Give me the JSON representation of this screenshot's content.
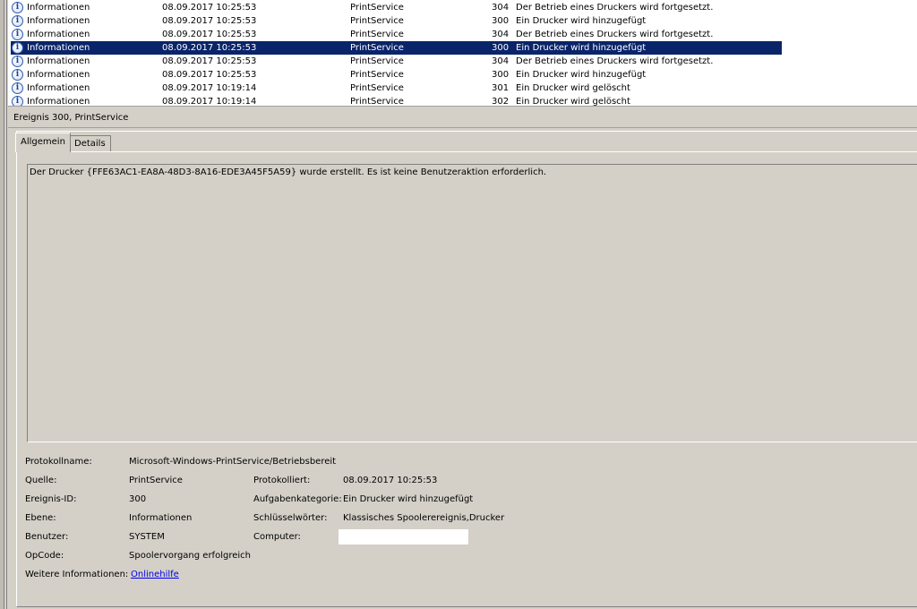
{
  "events": [
    {
      "level": "Informationen",
      "date": "08.09.2017 10:25:53",
      "source": "PrintService",
      "id": "304",
      "category": "Der Betrieb eines Druckers wird fortgesetzt.",
      "selected": false
    },
    {
      "level": "Informationen",
      "date": "08.09.2017 10:25:53",
      "source": "PrintService",
      "id": "300",
      "category": "Ein Drucker wird hinzugefügt",
      "selected": false
    },
    {
      "level": "Informationen",
      "date": "08.09.2017 10:25:53",
      "source": "PrintService",
      "id": "304",
      "category": "Der Betrieb eines Druckers wird fortgesetzt.",
      "selected": false
    },
    {
      "level": "Informationen",
      "date": "08.09.2017 10:25:53",
      "source": "PrintService",
      "id": "300",
      "category": "Ein Drucker wird hinzugefügt",
      "selected": true
    },
    {
      "level": "Informationen",
      "date": "08.09.2017 10:25:53",
      "source": "PrintService",
      "id": "304",
      "category": "Der Betrieb eines Druckers wird fortgesetzt.",
      "selected": false
    },
    {
      "level": "Informationen",
      "date": "08.09.2017 10:25:53",
      "source": "PrintService",
      "id": "300",
      "category": "Ein Drucker wird hinzugefügt",
      "selected": false
    },
    {
      "level": "Informationen",
      "date": "08.09.2017 10:19:14",
      "source": "PrintService",
      "id": "301",
      "category": "Ein Drucker wird gelöscht",
      "selected": false
    },
    {
      "level": "Informationen",
      "date": "08.09.2017 10:19:14",
      "source": "PrintService",
      "id": "302",
      "category": "Ein Drucker wird gelöscht",
      "selected": false
    }
  ],
  "detail": {
    "header": "Ereignis 300, PrintService",
    "tabs": [
      "Allgemein",
      "Details"
    ],
    "description": "Der Drucker {FFE63AC1-EA8A-48D3-8A16-EDE3A45F5A59} wurde erstellt. Es ist keine Benutzeraktion erforderlich.",
    "props": {
      "protokollname_label": "Protokollname:",
      "protokollname": "Microsoft-Windows-PrintService/Betriebsbereit",
      "quelle_label": "Quelle:",
      "quelle": "PrintService",
      "protokolliert_label": "Protokolliert:",
      "protokolliert": "08.09.2017 10:25:53",
      "ereignis_id_label": "Ereignis-ID:",
      "ereignis_id": "300",
      "aufgabenkategorie_label": "Aufgabenkategorie:",
      "aufgabenkategorie": "Ein Drucker wird hinzugefügt",
      "ebene_label": "Ebene:",
      "ebene": "Informationen",
      "schluesselwoerter_label": "Schlüsselwörter:",
      "schluesselwoerter": "Klassisches Spoolerereignis,Drucker",
      "benutzer_label": "Benutzer:",
      "benutzer": "SYSTEM",
      "computer_label": "Computer:",
      "opcode_label": "OpCode:",
      "opcode": "Spoolervorgang erfolgreich",
      "weitere_label": "Weitere Informationen:",
      "weitere_link": "Onlinehilfe"
    }
  },
  "icons": {
    "info": "information-icon"
  },
  "colors": {
    "selection": "#0a246a",
    "link": "#0000ee",
    "background": "#d4d0c8"
  }
}
